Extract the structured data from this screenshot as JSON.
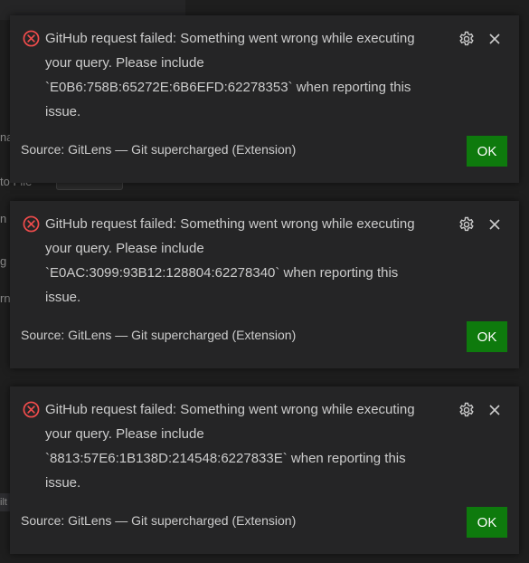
{
  "background": {
    "hints": [
      {
        "text": "na"
      },
      {
        "text": "to File"
      },
      {
        "text": "n"
      },
      {
        "text": "g"
      },
      {
        "text": "rn"
      },
      {
        "text": "ilt"
      }
    ]
  },
  "colors": {
    "toast_bg": "#252526",
    "text": "#cccccc",
    "error": "#f14c4c",
    "ok_button": "#0e7a0d"
  },
  "icons": {
    "error": "error-circle-x-icon",
    "settings": "gear-icon",
    "close": "close-x-icon"
  },
  "notifications": [
    {
      "message": "GitHub request failed: Something went wrong while executing\nyour query. Please include\n`E0B6:758B:65272E:6B6EFD:62278353` when reporting this\nissue.",
      "source": "Source: GitLens — Git supercharged (Extension)",
      "ok_label": "OK"
    },
    {
      "message": "GitHub request failed: Something went wrong while executing\nyour query. Please include\n`E0AC:3099:93B12:128804:62278340` when reporting this\nissue.",
      "source": "Source: GitLens — Git supercharged (Extension)",
      "ok_label": "OK"
    },
    {
      "message": "GitHub request failed: Something went wrong while executing\nyour query. Please include\n`8813:57E6:1B138D:214548:6227833E` when reporting this\nissue.",
      "source": "Source: GitLens — Git supercharged (Extension)",
      "ok_label": "OK"
    }
  ]
}
